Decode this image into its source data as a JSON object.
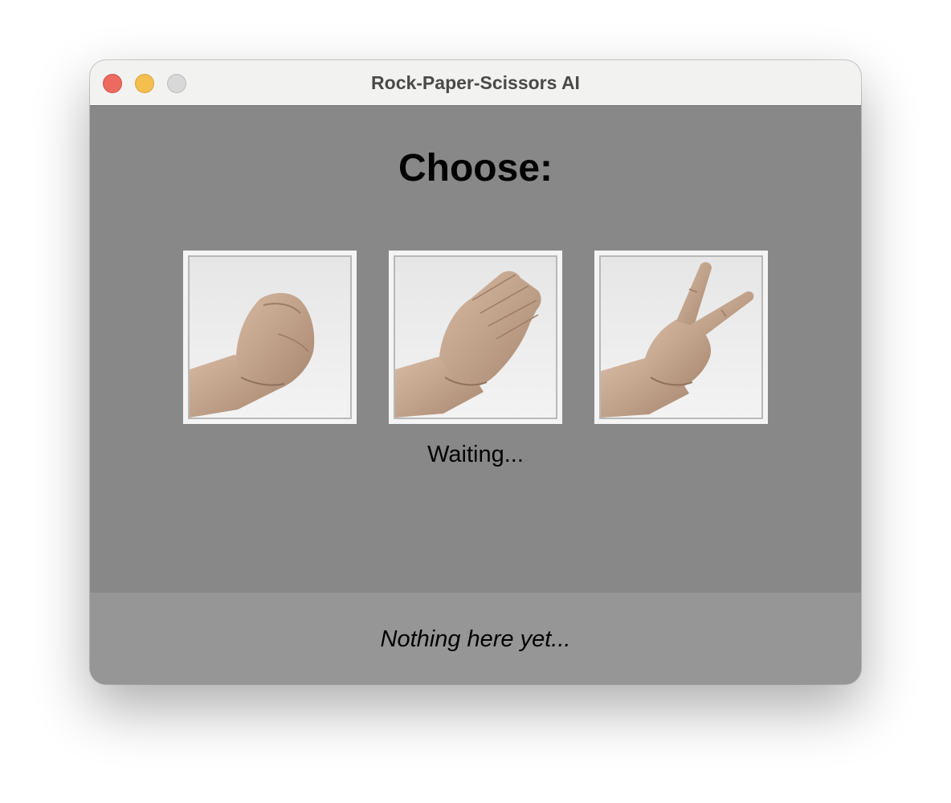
{
  "window": {
    "title": "Rock-Paper-Scissors AI",
    "controls": [
      "close",
      "minimize",
      "zoom"
    ]
  },
  "main": {
    "heading": "Choose:",
    "choices": [
      {
        "id": "rock",
        "icon": "fist-hand-icon"
      },
      {
        "id": "paper",
        "icon": "flat-hand-icon"
      },
      {
        "id": "scissors",
        "icon": "two-finger-hand-icon"
      }
    ],
    "status": "Waiting..."
  },
  "footer": {
    "message": "Nothing here yet..."
  },
  "colors": {
    "content_bg": "#888888",
    "footer_bg": "#969696",
    "titlebar_bg": "#f2f2f0",
    "close": "#ec6a5e",
    "minimize": "#f4bf4f",
    "zoom_inactive": "#d8d8d8",
    "skin": "#c9a68c"
  }
}
